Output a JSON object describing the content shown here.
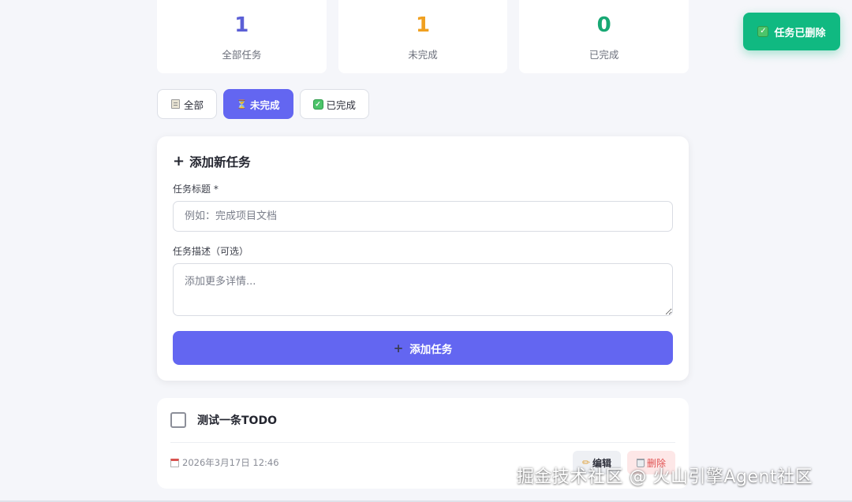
{
  "stats": [
    {
      "value": "1",
      "label": "全部任务",
      "color": "#5b5fd6"
    },
    {
      "value": "1",
      "label": "未完成",
      "color": "#f0a020"
    },
    {
      "value": "0",
      "label": "已完成",
      "color": "#18a874"
    }
  ],
  "toast": {
    "icon": "check-box-icon",
    "text": "任务已删除",
    "color": "#10b981"
  },
  "filters": [
    {
      "icon": "clipboard-icon",
      "label": "全部",
      "active": false
    },
    {
      "icon": "hourglass-icon",
      "label": "未完成",
      "active": true
    },
    {
      "icon": "check-box-icon",
      "label": "已完成",
      "active": false
    }
  ],
  "form": {
    "title_icon": "plus-icon",
    "title": "添加新任务",
    "title_label": "任务标题 *",
    "title_placeholder": "例如：完成项目文档",
    "title_value": "",
    "desc_label": "任务描述（可选）",
    "desc_placeholder": "添加更多详情...",
    "desc_value": "",
    "submit_icon": "plus-icon",
    "submit_label": "添加任务",
    "accent": "#6366f1"
  },
  "todos": [
    {
      "title": "测试一条TODO",
      "done": false,
      "date_icon": "calendar-icon",
      "date": "2026年3月17日 12:46",
      "edit_icon": "pencil-icon",
      "edit_label": "编辑",
      "delete_icon": "trash-icon",
      "delete_label": "删除"
    }
  ],
  "watermark": "掘金技术社区 @ 火山引擎Agent社区"
}
